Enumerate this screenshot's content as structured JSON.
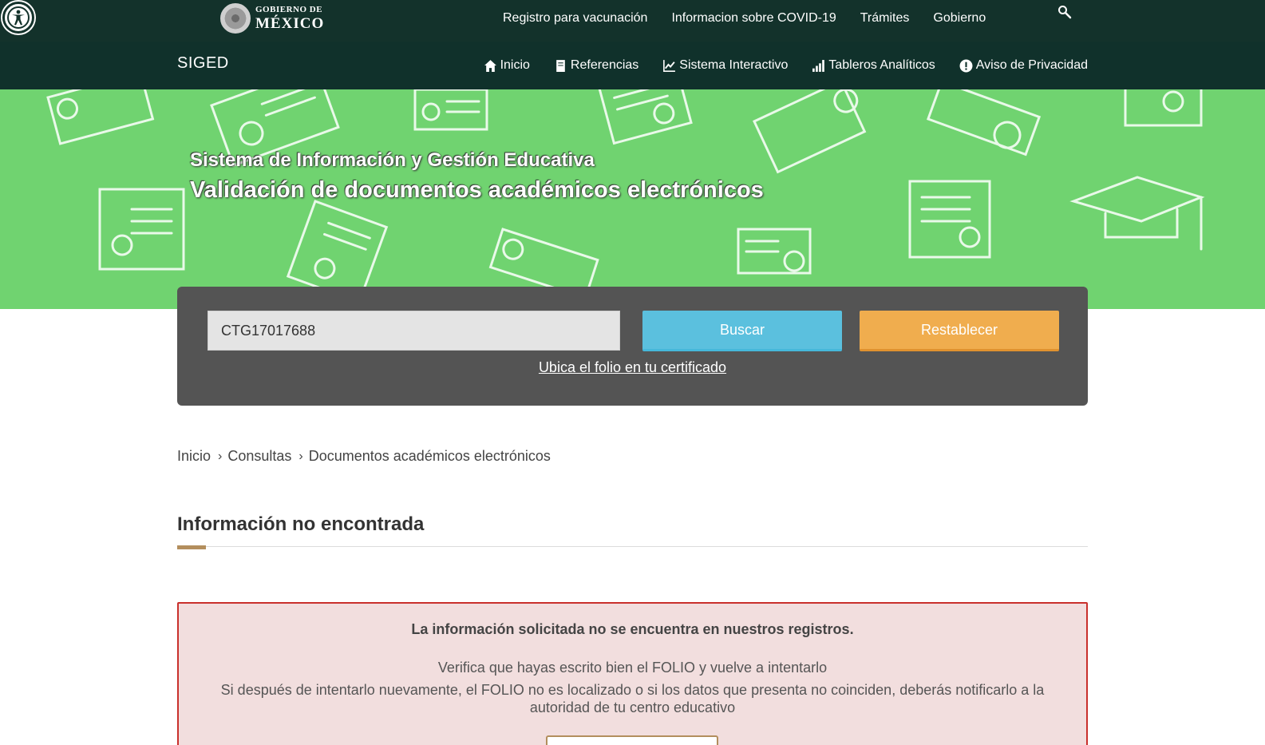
{
  "gov_bar": {
    "accessibility_label": "",
    "logo_line1": "GOBIERNO DE",
    "logo_line2": "MÉXICO",
    "nav": [
      "Registro para vacunación",
      "Informacion sobre COVID-19",
      "Trámites",
      "Gobierno"
    ]
  },
  "siged_bar": {
    "brand": "SIGED",
    "nav": [
      {
        "label": "Inicio",
        "icon": "home-icon"
      },
      {
        "label": "Referencias",
        "icon": "book-icon"
      },
      {
        "label": "Sistema Interactivo",
        "icon": "line-chart-icon"
      },
      {
        "label": "Tableros Analíticos",
        "icon": "signal-bars-icon"
      },
      {
        "label": "Aviso de Privacidad",
        "icon": "exclamation-circle-icon"
      }
    ]
  },
  "hero": {
    "subtitle": "Sistema de Información y Gestión Educativa",
    "title": "Validación de documentos académicos electrónicos"
  },
  "search": {
    "folio_value": "CTG17017688",
    "search_button": "Buscar",
    "reset_button": "Restablecer",
    "folio_help_link": "Ubica el folio en tu certificado"
  },
  "breadcrumb": [
    "Inicio",
    "Consultas",
    "Documentos académicos electrónicos"
  ],
  "section_title": "Información no encontrada",
  "alert": {
    "heading": "La información solicitada no se encuentra en nuestros registros.",
    "line1": "Verifica que hayas escrito bien el FOLIO y vuelve a intentarlo",
    "line2": "Si después de intentarlo nuevamente, el FOLIO no es localizado o si los datos que presenta no coinciden, deberás notificarlo a la autoridad de tu centro educativo"
  },
  "colors": {
    "gov_bar": "#13322b",
    "siged_bar": "#10312b",
    "hero_green": "#70d370",
    "panel": "#545454",
    "buscar": "#5bc0de",
    "restablecer": "#f0ad4e",
    "accent": "#b38e5d",
    "alert_bg": "#f2dede",
    "alert_border": "#c9302c"
  }
}
